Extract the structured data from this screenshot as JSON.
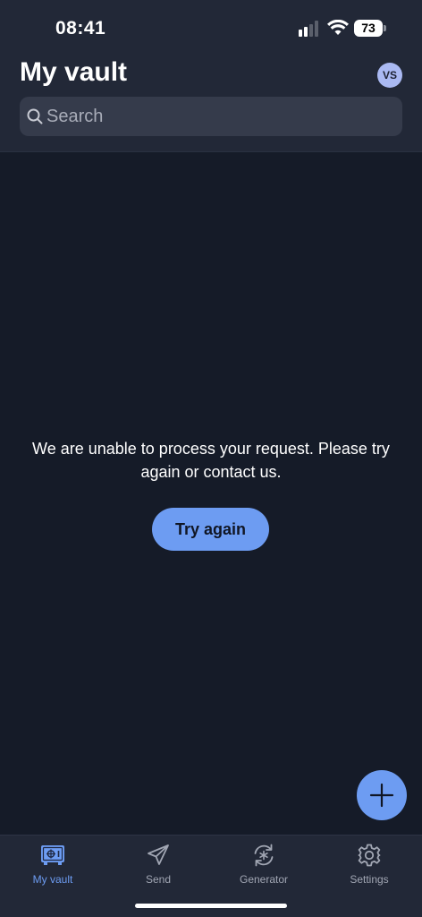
{
  "status_bar": {
    "time": "08:41",
    "battery": "73"
  },
  "header": {
    "title": "My vault",
    "avatar_initials": "VS"
  },
  "search": {
    "placeholder": "Search"
  },
  "error": {
    "message": "We are unable to process your request. Please try again or contact us.",
    "retry_label": "Try again"
  },
  "fab": {
    "icon": "plus-icon"
  },
  "tabs": [
    {
      "label": "My vault",
      "icon": "vault-icon",
      "active": true
    },
    {
      "label": "Send",
      "icon": "send-icon",
      "active": false
    },
    {
      "label": "Generator",
      "icon": "generator-icon",
      "active": false
    },
    {
      "label": "Settings",
      "icon": "gear-icon",
      "active": false
    }
  ],
  "colors": {
    "background": "#151b28",
    "header": "#222837",
    "accent": "#6d9cf2",
    "avatar": "#aab9f2"
  }
}
